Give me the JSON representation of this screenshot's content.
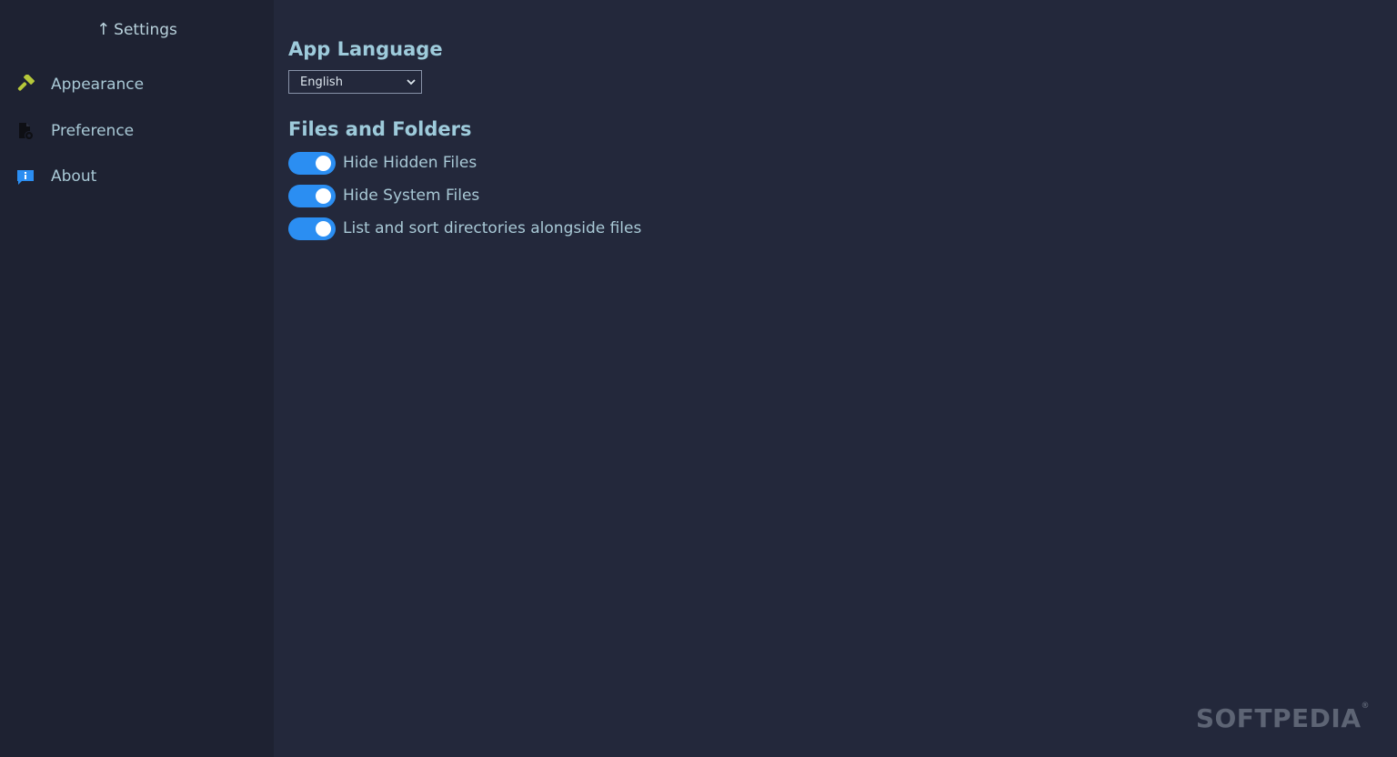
{
  "sidebar": {
    "header": {
      "arrow": "↑",
      "label": "Settings"
    },
    "items": [
      {
        "label": "Appearance",
        "icon": "hammer-icon",
        "icon_color": "#b6c83a"
      },
      {
        "label": "Preference",
        "icon": "file-settings-icon",
        "icon_color": "#0e0f14"
      },
      {
        "label": "About",
        "icon": "info-chat-icon",
        "icon_color": "#2b8ef2"
      }
    ]
  },
  "main": {
    "language": {
      "title": "App Language",
      "selected": "English"
    },
    "files": {
      "title": "Files and Folders",
      "toggles": [
        {
          "label": "Hide Hidden Files",
          "on": true
        },
        {
          "label": "Hide System Files",
          "on": true
        },
        {
          "label": "List and sort directories alongside files",
          "on": true
        }
      ]
    }
  },
  "watermark": {
    "text": "SOFTPEDIA",
    "mark": "®"
  },
  "colors": {
    "background": "#23283b",
    "sidebar": "#1e2232",
    "accent": "#2b8ef2",
    "heading": "#9ecbdb",
    "text": "#a9c9d6"
  }
}
